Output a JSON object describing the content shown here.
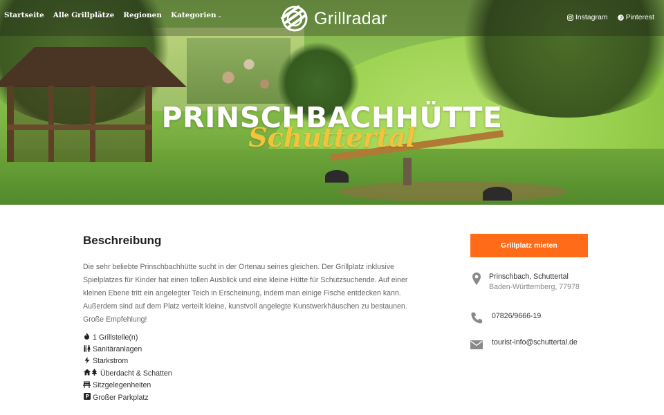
{
  "nav": {
    "items": [
      {
        "label": "Startseite"
      },
      {
        "label": "Alle Grillplätze"
      },
      {
        "label": "Regionen"
      },
      {
        "label": "Kategorien",
        "has_dropdown": true
      }
    ],
    "logo_text": "Grillradar",
    "socials": [
      {
        "label": "Instagram",
        "icon": "instagram-icon"
      },
      {
        "label": "Pinterest",
        "icon": "pinterest-icon"
      }
    ]
  },
  "hero": {
    "title": "PRINSCHBACHHÜTTE",
    "subtitle": "Schuttertal"
  },
  "description": {
    "heading": "Beschreibung",
    "text": "Die sehr beliebte Prinschbachhütte sucht in der Ortenau seines gleichen. Der Grillplatz inklusive Spielplatzes für Kinder hat einen tollen Ausblick und eine kleine Hütte für Schutzsuchende. Auf einer kleinen Ebene tritt ein angelegter Teich in Erscheinung, indem man einige Fische entdecken kann. Außerdem sind auf dem Platz verteilt kleine, kunstvoll angelegte Kunstwerkhäuschen zu bestaunen. Große Empfehlung!"
  },
  "features": [
    {
      "label": "1 Grillstelle(n)",
      "icon": "fire-icon"
    },
    {
      "label": "Sanitäranlagen",
      "icon": "restroom-icon"
    },
    {
      "label": "Starkstrom",
      "icon": "bolt-icon"
    },
    {
      "label": "Überdacht & Schatten",
      "icon": "house-tree-icon"
    },
    {
      "label": "Sitzgelegenheiten",
      "icon": "bench-icon"
    },
    {
      "label": "Großer Parkplatz",
      "icon": "parking-icon"
    }
  ],
  "sidebar": {
    "rent_button": "Grillplatz mieten",
    "address_line1": "Prinschbach, Schuttertal",
    "address_line2": "Baden-Württemberg, 77978",
    "phone": "07826/9666-19",
    "email": "tourist-info@schuttertal.de"
  },
  "colors": {
    "accent": "#ff6b17",
    "subtitle": "#f2c33b",
    "icon_gray": "#8a8a8a"
  }
}
